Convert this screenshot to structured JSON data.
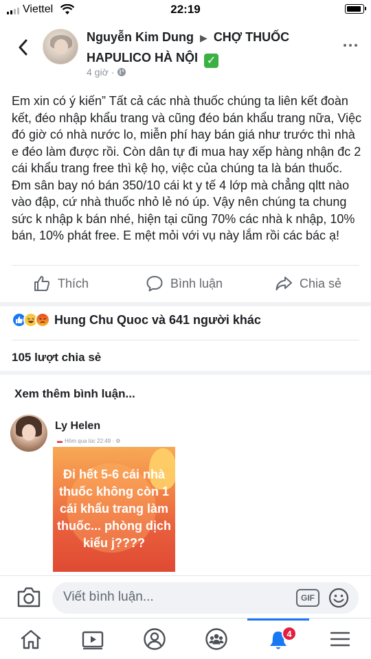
{
  "status_bar": {
    "carrier": "Viettel",
    "time": "22:19"
  },
  "post": {
    "author": "Nguyễn Kim Dung",
    "separator": "▶",
    "group": "CHỢ THUỐC HAPULICO HÀ NỘI",
    "badge_glyph": "✓",
    "time": "4 giờ",
    "meta_separator": "·",
    "privacy_icon": "globe-icon",
    "text": "Em xin có ý kiến” Tất cả các nhà thuốc chúng ta liên kết đoàn kết, đéo nhập khẩu trang và cũng đéo bán khẩu trang nữa, Việc đó giờ có nhà nước lo, miễn phí hay bán giá như trước thì nhà e đéo làm được rồi. Còn dân tự đi mua hay xếp hàng nhận đc 2 cái khẩu trang free thì kệ họ, việc của chúng ta là bán thuốc. Đm sân bay nó bán 350/10 cái kt y tế 4 lớp mà chẳng qltt nào vào đập, cứ nhà thuốc nhỏ lẻ nó úp. Vậy nên chúng ta chung sức k nhập k bán nhé, hiện tại cũng 70% các nhà k nhập, 10% bán, 10% phát free. E mệt mỏi với vụ này lắm rồi các bác ạ!"
  },
  "actions": {
    "like": "Thích",
    "comment": "Bình luận",
    "share": "Chia sẻ"
  },
  "reactions": {
    "icons": [
      "like-icon",
      "haha-icon",
      "angry-icon"
    ],
    "text": "Hung Chu Quoc và 641 người khác"
  },
  "shares_text": "105 lượt chia sẻ",
  "more_comments": "Xem thêm bình luận...",
  "comment": {
    "author": "Ly Helen",
    "image_meta": "Hôm qua lúc 22:49 · ⚙",
    "image_text": "Đi hết 5-6 cái nhà thuốc không còn 1 cái khẩu trang làm thuốc... phòng dịch kiểu j????"
  },
  "composer": {
    "placeholder": "Viết bình luận...",
    "gif_label": "GIF"
  },
  "tab_bar": {
    "items": [
      {
        "icon": "home-icon"
      },
      {
        "icon": "watch-icon"
      },
      {
        "icon": "profile-icon"
      },
      {
        "icon": "groups-icon"
      },
      {
        "icon": "notifications-icon",
        "badge": "4",
        "active": true
      },
      {
        "icon": "menu-icon"
      }
    ]
  },
  "colors": {
    "accent": "#1877f2",
    "badge": "#e41e3f",
    "text": "#1c1e21",
    "secondary_text": "#65676b"
  }
}
